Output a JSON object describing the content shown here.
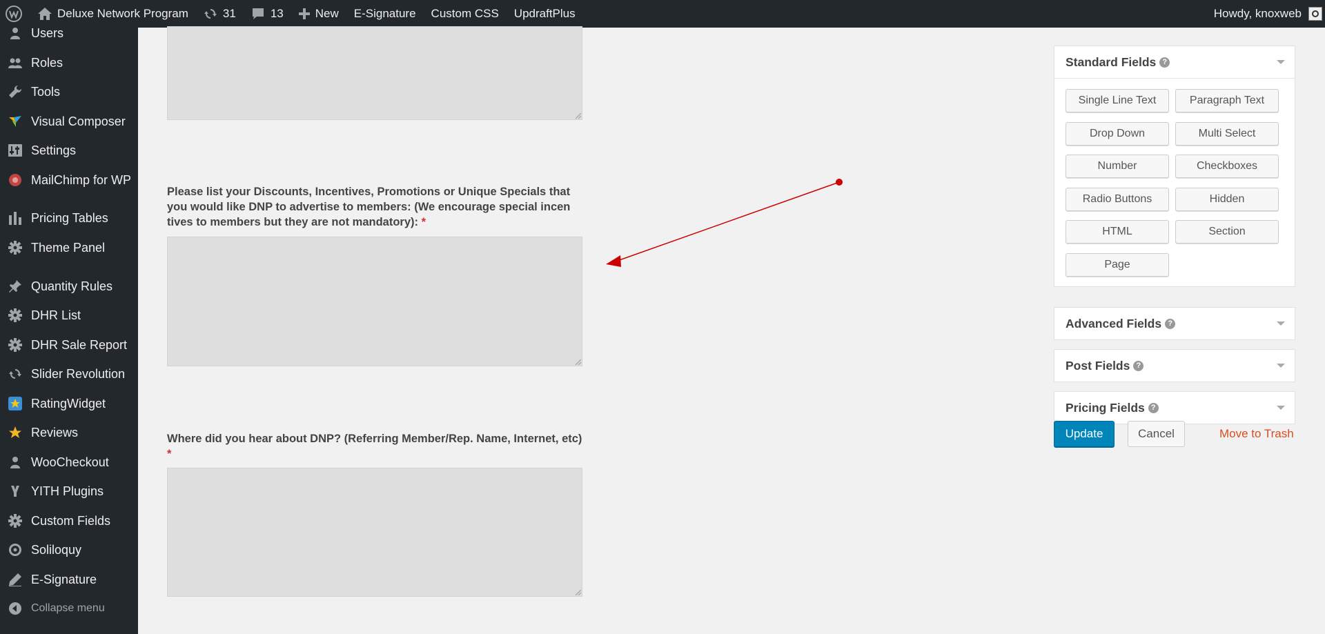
{
  "adminbar": {
    "site_name": "Deluxe Network Program",
    "updates_count": "31",
    "comments_count": "13",
    "new_label": "New",
    "links": [
      "E-Signature",
      "Custom CSS",
      "UpdraftPlus"
    ],
    "greeting": "Howdy, knoxweb"
  },
  "sidebar": {
    "items": [
      {
        "label": "Users",
        "icon": "users-icon"
      },
      {
        "label": "Roles",
        "icon": "roles-icon"
      },
      {
        "label": "Tools",
        "icon": "wrench-icon"
      },
      {
        "label": "Visual Composer",
        "icon": "visual-composer-icon"
      },
      {
        "label": "Settings",
        "icon": "settings-icon"
      },
      {
        "label": "MailChimp for WP",
        "icon": "mailchimp-icon"
      },
      {
        "label": "Pricing Tables",
        "icon": "bar-chart-icon"
      },
      {
        "label": "Theme Panel",
        "icon": "gear-icon"
      },
      {
        "label": "Quantity Rules",
        "icon": "pushpin-icon"
      },
      {
        "label": "DHR List",
        "icon": "gear-icon"
      },
      {
        "label": "DHR Sale Report",
        "icon": "gear-icon"
      },
      {
        "label": "Slider Revolution",
        "icon": "refresh-icon"
      },
      {
        "label": "RatingWidget",
        "icon": "star-badge-icon"
      },
      {
        "label": "Reviews",
        "icon": "star-icon"
      },
      {
        "label": "WooCheckout",
        "icon": "user-icon"
      },
      {
        "label": "YITH Plugins",
        "icon": "yith-icon"
      },
      {
        "label": "Custom Fields",
        "icon": "gear-icon"
      },
      {
        "label": "Soliloquy",
        "icon": "soliloquy-icon"
      },
      {
        "label": "E-Signature",
        "icon": "pen-icon"
      }
    ],
    "collapse_label": "Collapse menu"
  },
  "form": {
    "q_discounts": {
      "label": "Please list your Discounts, Incentives, Promotions or Unique Specials that you would like DNP to advertise to members: (We encourage special incen tives to members but they are not mandatory):",
      "required_mark": "*"
    },
    "q_referral": {
      "label": "Where did you hear about DNP? (Referring Member/Rep. Name, Internet, etc)",
      "required_mark": "*"
    }
  },
  "panel": {
    "standard": {
      "title": "Standard Fields",
      "buttons": [
        "Single Line Text",
        "Paragraph Text",
        "Drop Down",
        "Multi Select",
        "Number",
        "Checkboxes",
        "Radio Buttons",
        "Hidden",
        "HTML",
        "Section",
        "Page"
      ]
    },
    "advanced": {
      "title": "Advanced Fields"
    },
    "post": {
      "title": "Post Fields"
    },
    "pricing": {
      "title": "Pricing Fields"
    },
    "update_label": "Update",
    "cancel_label": "Cancel",
    "trash_label": "Move to Trash"
  },
  "colors": {
    "adminbar_bg": "#23282d",
    "primary_button": "#0085ba",
    "required": "#cc3333",
    "annotation_arrow": "#cc0000",
    "trash_link": "#d54e21"
  }
}
